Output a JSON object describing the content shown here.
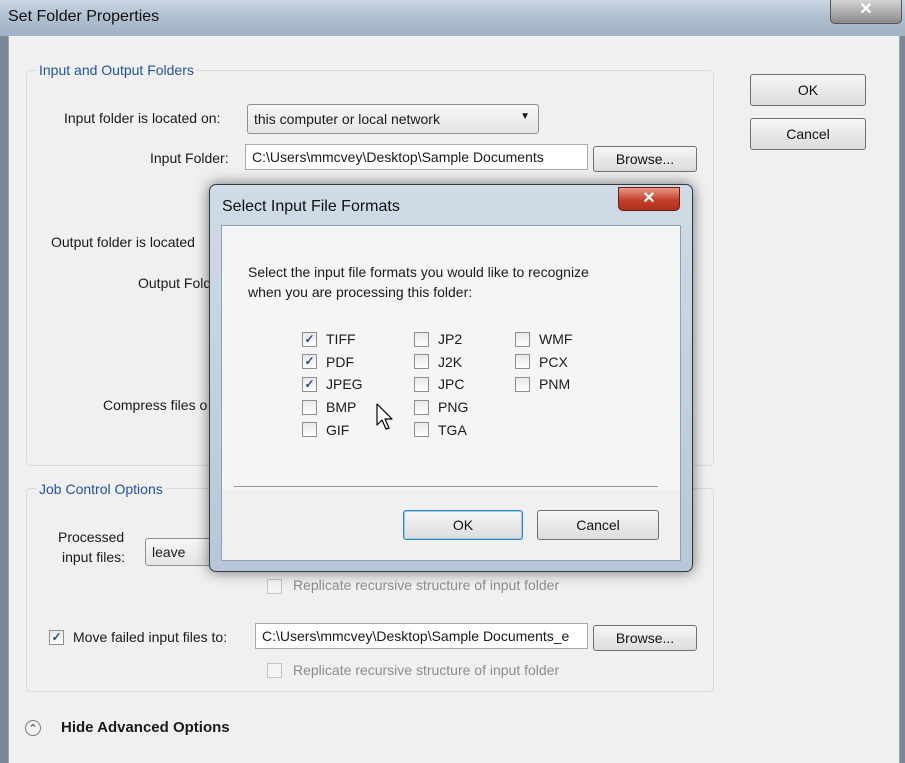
{
  "outer": {
    "title": "Set Folder Properties",
    "close_glyph": "✕",
    "ok_label": "OK",
    "cancel_label": "Cancel",
    "io_group_label": "Input and Output Folders",
    "input_location_label": "Input folder is located on:",
    "input_location_value": "this computer or local network",
    "input_folder_label": "Input Folder:",
    "input_folder_value": "C:\\Users\\mmcvey\\Desktop\\Sample Documents",
    "browse_label": "Browse...",
    "output_location_label": "Output folder is located",
    "output_folder_label": "Output Fold",
    "compress_label": "Compress files o",
    "job_group_label": "Job Control Options",
    "processed_label_line1": "Processed",
    "processed_label_line2": "input files:",
    "processed_value": "leave",
    "replicate_label": "Replicate recursive structure of input folder",
    "move_failed_label": "Move failed input files to:",
    "move_failed_value": "C:\\Users\\mmcvey\\Desktop\\Sample Documents_e",
    "hide_advanced_label": "Hide Advanced Options",
    "move_failed_checked": true
  },
  "modal": {
    "title": "Select Input File Formats",
    "close_glyph": "✕",
    "instruction_line1": "Select the input file formats you would like to recognize",
    "instruction_line2": "when you are processing this folder:",
    "ok_label": "OK",
    "cancel_label": "Cancel",
    "formats": [
      {
        "label": "TIFF",
        "checked": true
      },
      {
        "label": "PDF",
        "checked": true
      },
      {
        "label": "JPEG",
        "checked": true
      },
      {
        "label": "BMP",
        "checked": false
      },
      {
        "label": "GIF",
        "checked": false
      },
      {
        "label": "JP2",
        "checked": false
      },
      {
        "label": "J2K",
        "checked": false
      },
      {
        "label": "JPC",
        "checked": false
      },
      {
        "label": "PNG",
        "checked": false
      },
      {
        "label": "TGA",
        "checked": false
      },
      {
        "label": "WMF",
        "checked": false
      },
      {
        "label": "PCX",
        "checked": false
      },
      {
        "label": "PNM",
        "checked": false
      }
    ]
  },
  "icons": {
    "check": "✓",
    "dropdown": "▼",
    "collapse": "⌃"
  },
  "colors": {
    "group_label": "#2352a0",
    "modal_close": "#c4402a"
  }
}
